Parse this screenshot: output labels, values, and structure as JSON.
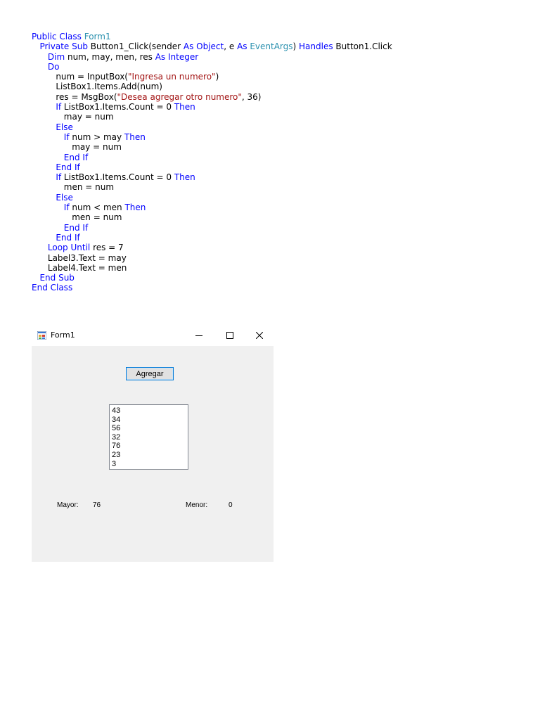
{
  "code": {
    "lines": [
      [
        {
          "t": "Public Class ",
          "c": "kw"
        },
        {
          "t": "Form1",
          "c": "type"
        }
      ],
      [
        {
          "t": "   ",
          "c": "plain"
        },
        {
          "t": "Private Sub ",
          "c": "kw"
        },
        {
          "t": "Button1_Click(sender ",
          "c": "plain"
        },
        {
          "t": "As ",
          "c": "kw"
        },
        {
          "t": "Object",
          "c": "kw"
        },
        {
          "t": ", e ",
          "c": "plain"
        },
        {
          "t": "As ",
          "c": "kw"
        },
        {
          "t": "EventArgs",
          "c": "type"
        },
        {
          "t": ") ",
          "c": "plain"
        },
        {
          "t": "Handles ",
          "c": "kw"
        },
        {
          "t": "Button1.Click",
          "c": "plain"
        }
      ],
      [
        {
          "t": "      ",
          "c": "plain"
        },
        {
          "t": "Dim ",
          "c": "kw"
        },
        {
          "t": "num, may, men, res ",
          "c": "plain"
        },
        {
          "t": "As ",
          "c": "kw"
        },
        {
          "t": "Integer",
          "c": "kw"
        }
      ],
      [
        {
          "t": "      ",
          "c": "plain"
        },
        {
          "t": "Do",
          "c": "kw"
        }
      ],
      [
        {
          "t": "         num = InputBox(",
          "c": "plain"
        },
        {
          "t": "\"Ingresa un numero\"",
          "c": "str"
        },
        {
          "t": ")",
          "c": "plain"
        }
      ],
      [
        {
          "t": "         ListBox1.Items.Add(num)",
          "c": "plain"
        }
      ],
      [
        {
          "t": "         res = MsgBox(",
          "c": "plain"
        },
        {
          "t": "\"Desea agregar otro numero\"",
          "c": "str"
        },
        {
          "t": ", 36)",
          "c": "plain"
        }
      ],
      [
        {
          "t": "         ",
          "c": "plain"
        },
        {
          "t": "If ",
          "c": "kw"
        },
        {
          "t": "ListBox1.Items.Count = 0 ",
          "c": "plain"
        },
        {
          "t": "Then",
          "c": "kw"
        }
      ],
      [
        {
          "t": "            may = num",
          "c": "plain"
        }
      ],
      [
        {
          "t": "         ",
          "c": "plain"
        },
        {
          "t": "Else",
          "c": "kw"
        }
      ],
      [
        {
          "t": "            ",
          "c": "plain"
        },
        {
          "t": "If ",
          "c": "kw"
        },
        {
          "t": "num > may ",
          "c": "plain"
        },
        {
          "t": "Then",
          "c": "kw"
        }
      ],
      [
        {
          "t": "               may = num",
          "c": "plain"
        }
      ],
      [
        {
          "t": "            ",
          "c": "plain"
        },
        {
          "t": "End If",
          "c": "kw"
        }
      ],
      [
        {
          "t": "         ",
          "c": "plain"
        },
        {
          "t": "End If",
          "c": "kw"
        }
      ],
      [
        {
          "t": "         ",
          "c": "plain"
        },
        {
          "t": "If ",
          "c": "kw"
        },
        {
          "t": "ListBox1.Items.Count = 0 ",
          "c": "plain"
        },
        {
          "t": "Then",
          "c": "kw"
        }
      ],
      [
        {
          "t": "            men = num",
          "c": "plain"
        }
      ],
      [
        {
          "t": "         ",
          "c": "plain"
        },
        {
          "t": "Else",
          "c": "kw"
        }
      ],
      [
        {
          "t": "            ",
          "c": "plain"
        },
        {
          "t": "If ",
          "c": "kw"
        },
        {
          "t": "num < men ",
          "c": "plain"
        },
        {
          "t": "Then",
          "c": "kw"
        }
      ],
      [
        {
          "t": "               men = num",
          "c": "plain"
        }
      ],
      [
        {
          "t": "            ",
          "c": "plain"
        },
        {
          "t": "End If",
          "c": "kw"
        }
      ],
      [
        {
          "t": "         ",
          "c": "plain"
        },
        {
          "t": "End If",
          "c": "kw"
        }
      ],
      [
        {
          "t": "      ",
          "c": "plain"
        },
        {
          "t": "Loop Until ",
          "c": "kw"
        },
        {
          "t": "res = 7",
          "c": "plain"
        }
      ],
      [
        {
          "t": "      Label3.Text = may",
          "c": "plain"
        }
      ],
      [
        {
          "t": "      Label4.Text = men",
          "c": "plain"
        }
      ],
      [
        {
          "t": "   ",
          "c": "plain"
        },
        {
          "t": "End Sub",
          "c": "kw"
        }
      ],
      [
        {
          "t": "End Class",
          "c": "kw"
        }
      ]
    ]
  },
  "form": {
    "title": "Form1",
    "button_label": "Agregar",
    "list_items": [
      "43",
      "34",
      "56",
      "32",
      "76",
      "23",
      "3"
    ],
    "mayor_label": "Mayor:",
    "mayor_value": "76",
    "menor_label": "Menor:",
    "menor_value": "0",
    "icons": {
      "app": "windows-form-icon",
      "minimize": "minimize-icon",
      "maximize": "maximize-icon",
      "close": "close-icon"
    }
  },
  "colors": {
    "keyword": "#0000ff",
    "type": "#2b91af",
    "string": "#a31515",
    "form_background": "#f0f0f0",
    "button_border": "#0078d7"
  }
}
